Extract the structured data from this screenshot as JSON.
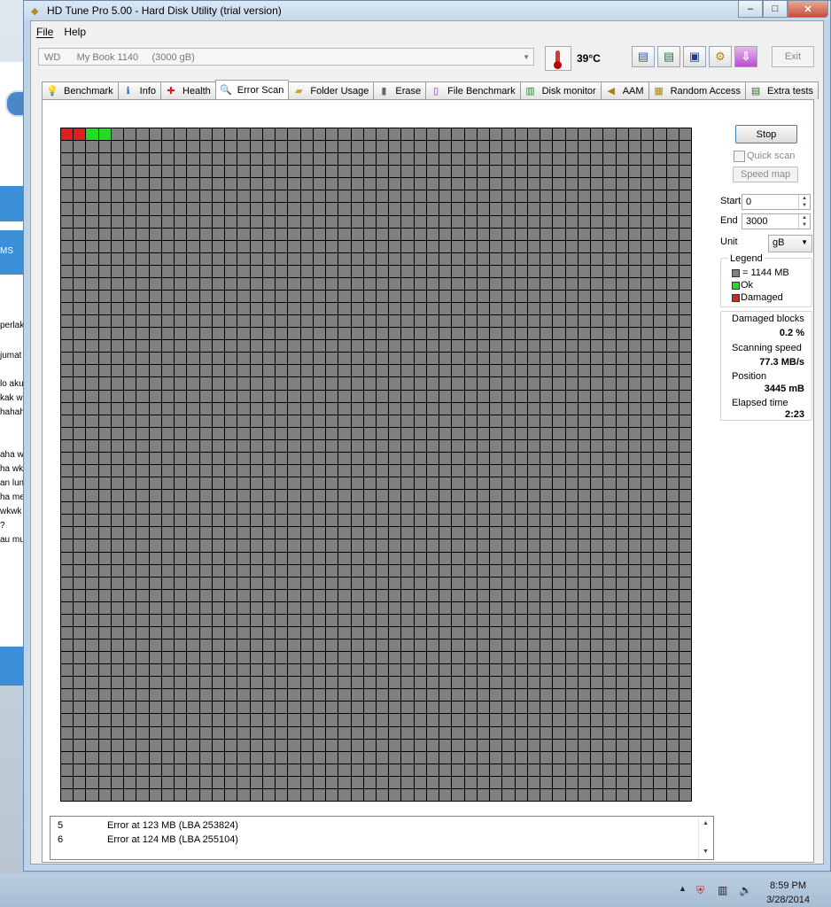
{
  "background": {
    "left_snippets": [
      "MS",
      "perlak",
      "jumat",
      "lo aku",
      "kak wk",
      "hahaha",
      "aha wk",
      "ha wkw",
      "an lum",
      "ha me",
      "wkwk",
      "?",
      "au mu"
    ]
  },
  "window": {
    "title": "HD Tune Pro 5.00 - Hard Disk Utility (trial version)",
    "controls": {
      "minimize": "–",
      "maximize": "□",
      "close": "✕"
    }
  },
  "menu": {
    "file": "File",
    "help": "Help"
  },
  "toolbar": {
    "drive": "WD      My Book 1140     (3000 gB)",
    "temperature": "39°C",
    "exit_label": "Exit"
  },
  "tabs": [
    {
      "label": "Benchmark",
      "icon": "lightbulb-icon"
    },
    {
      "label": "Info",
      "icon": "info-icon"
    },
    {
      "label": "Health",
      "icon": "health-cross-icon"
    },
    {
      "label": "Error Scan",
      "icon": "magnifier-icon",
      "active": true
    },
    {
      "label": "Folder Usage",
      "icon": "folder-icon"
    },
    {
      "label": "Erase",
      "icon": "trash-icon"
    },
    {
      "label": "File Benchmark",
      "icon": "file-benchmark-icon"
    },
    {
      "label": "Disk monitor",
      "icon": "disk-monitor-icon"
    },
    {
      "label": "AAM",
      "icon": "speaker-icon"
    },
    {
      "label": "Random Access",
      "icon": "random-access-icon"
    },
    {
      "label": "Extra tests",
      "icon": "extra-tests-icon"
    }
  ],
  "scan_map": {
    "columns": 50,
    "rows": 54,
    "block_states": [
      "damaged",
      "damaged",
      "ok",
      "ok"
    ]
  },
  "controls": {
    "stop_label": "Stop",
    "quick_scan_label": "Quick scan",
    "speed_map_label": "Speed map",
    "start_label": "Start",
    "start_value": "0",
    "end_label": "End",
    "end_value": "3000",
    "unit_label": "Unit",
    "unit_value": "gB"
  },
  "legend": {
    "title": "Legend",
    "block": "= 1144 MB",
    "ok": "Ok",
    "damaged": "Damaged",
    "colors": {
      "block": "#808080",
      "ok": "#22dd22",
      "damaged": "#e02020"
    }
  },
  "stats": {
    "damaged_blocks_label": "Damaged blocks",
    "damaged_blocks_value": "0.2 %",
    "scanning_speed_label": "Scanning speed",
    "scanning_speed_value": "77.3 MB/s",
    "position_label": "Position",
    "position_value": "3445 mB",
    "elapsed_label": "Elapsed time",
    "elapsed_value": "2:23"
  },
  "log": [
    {
      "id": "5",
      "message": "Error at 123 MB (LBA 253824)"
    },
    {
      "id": "6",
      "message": "Error at 124 MB (LBA 255104)"
    }
  ],
  "taskbar": {
    "time": "8:59 PM",
    "date": "3/28/2014"
  }
}
